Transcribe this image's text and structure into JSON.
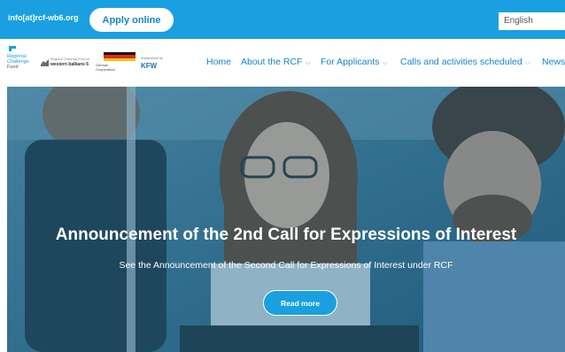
{
  "topbar": {
    "email": "info[at]rcf-wb6.org",
    "apply_label": "Apply online",
    "language": "English"
  },
  "logos": {
    "rcf_lines": [
      "Regional",
      "Challenge",
      "Fund"
    ],
    "western_balkans_small": "Regional Challenge Fund for",
    "western_balkans": "western balkans 6",
    "german_cooperation_lines": [
      "German",
      "Cooperation"
    ],
    "kfw_small": "Implemented by",
    "kfw": "KFW"
  },
  "nav": {
    "items": [
      {
        "label": "Home",
        "dropdown": false
      },
      {
        "label": "About the RCF",
        "dropdown": true
      },
      {
        "label": "For Applicants",
        "dropdown": true
      },
      {
        "label": "Calls and activities scheduled",
        "dropdown": true
      },
      {
        "label": "News",
        "dropdown": false
      }
    ],
    "chevron": "⌵"
  },
  "hero": {
    "title": "Announcement of the 2nd Call for Expressions of Interest",
    "subtitle": "See the Announcement of the Second Call for Expressions of Interest under RCF",
    "button_label": "Read more"
  },
  "colors": {
    "brand_blue": "#1aa0e0",
    "nav_text": "#1684c8",
    "hero_tint": "#1e6e96",
    "white": "#ffffff"
  },
  "icons": {
    "dropdown": "chevron-down-icon",
    "flag": "german-flag-icon",
    "rcf_mark": "rcf-logo-icon"
  }
}
